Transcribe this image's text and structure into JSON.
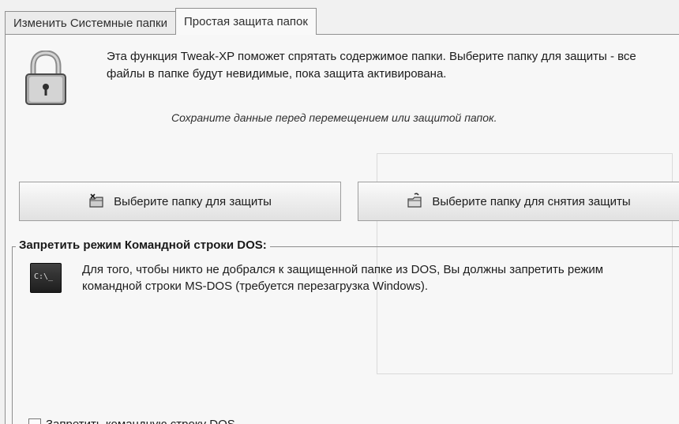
{
  "tabs": [
    {
      "label": "Изменить Системные папки",
      "active": false
    },
    {
      "label": "Простая защита папок",
      "active": true
    }
  ],
  "panel": {
    "intro": "Эта функция Tweak-XP поможет спрятать содержимое папки. Выберите папку для защиты - все файлы в папке будут невидимые, пока защита активирована.",
    "warning": "Сохраните данные перед перемещением или защитой папок.",
    "buttons": {
      "protect_label": "Выберите папку для защиты",
      "unprotect_label": "Выберите папку для снятия защиты"
    },
    "dos_group": {
      "title": "Запретить режим Командной строки DOS:",
      "icon_text": "C:\\_",
      "description": "Для того, чтобы никто не добрался к защищенной папке из DOS, Вы должны запретить режим командной строки MS-DOS (требуется перезагрузка Windows).",
      "checkbox_label": "Запретить командную строку DOS",
      "checkbox_checked": false
    }
  },
  "icons": {
    "lock": "padlock-icon",
    "protect": "folder-lock-icon",
    "unprotect": "folder-unlock-icon",
    "cmd": "command-prompt-icon"
  }
}
